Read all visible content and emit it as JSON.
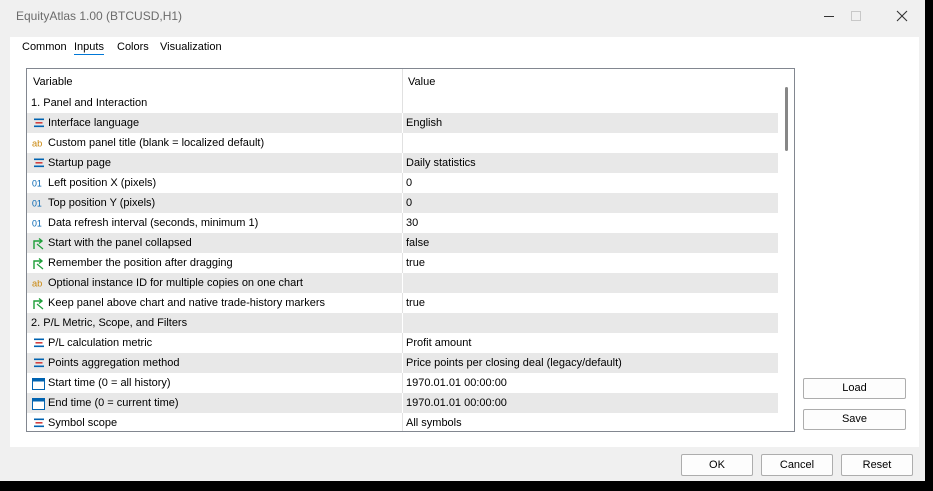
{
  "window": {
    "title": "EquityAtlas 1.00 (BTCUSD,H1)"
  },
  "tabs": [
    {
      "label": "Common"
    },
    {
      "label": "Inputs"
    },
    {
      "label": "Colors"
    },
    {
      "label": "Visualization"
    }
  ],
  "grid": {
    "col_variable": "Variable",
    "col_value": "Value",
    "rows": [
      {
        "icon": "group",
        "variable": "1. Panel and Interaction",
        "value": ""
      },
      {
        "icon": "enum-icon",
        "variable": "Interface language",
        "value": "English"
      },
      {
        "icon": "string-icon",
        "variable": "Custom panel title (blank = localized default)",
        "value": ""
      },
      {
        "icon": "enum-icon",
        "variable": "Startup page",
        "value": "Daily statistics"
      },
      {
        "icon": "int-icon",
        "variable": "Left position X (pixels)",
        "value": "0"
      },
      {
        "icon": "int-icon",
        "variable": "Top position Y (pixels)",
        "value": "0"
      },
      {
        "icon": "int-icon",
        "variable": "Data refresh interval (seconds, minimum 1)",
        "value": "30"
      },
      {
        "icon": "bool-icon",
        "variable": "Start with the panel collapsed",
        "value": "false"
      },
      {
        "icon": "bool-icon",
        "variable": "Remember the position after dragging",
        "value": "true"
      },
      {
        "icon": "string-icon",
        "variable": "Optional instance ID for multiple copies on one chart",
        "value": ""
      },
      {
        "icon": "bool-icon",
        "variable": "Keep panel above chart and native trade-history markers",
        "value": "true"
      },
      {
        "icon": "group",
        "variable": "2. P/L Metric, Scope, and Filters",
        "value": ""
      },
      {
        "icon": "enum-icon",
        "variable": "P/L calculation metric",
        "value": "Profit amount"
      },
      {
        "icon": "enum-icon",
        "variable": "Points aggregation method",
        "value": "Price points per closing deal (legacy/default)"
      },
      {
        "icon": "datetime-icon",
        "variable": "Start time (0 = all history)",
        "value": "1970.01.01 00:00:00"
      },
      {
        "icon": "datetime-icon",
        "variable": "End time (0 = current time)",
        "value": "1970.01.01 00:00:00"
      },
      {
        "icon": "enum-icon",
        "variable": "Symbol scope",
        "value": "All symbols"
      }
    ]
  },
  "side_buttons": {
    "load": "Load",
    "save": "Save"
  },
  "buttons": {
    "ok": "OK",
    "cancel": "Cancel",
    "reset": "Reset"
  },
  "colors": {
    "accent": "#0078d7",
    "alt_row": "#e8e8e8",
    "enum_icon": "#0063b1",
    "bool_icon": "#1e9e3a",
    "string_icon": "#c9860a"
  }
}
